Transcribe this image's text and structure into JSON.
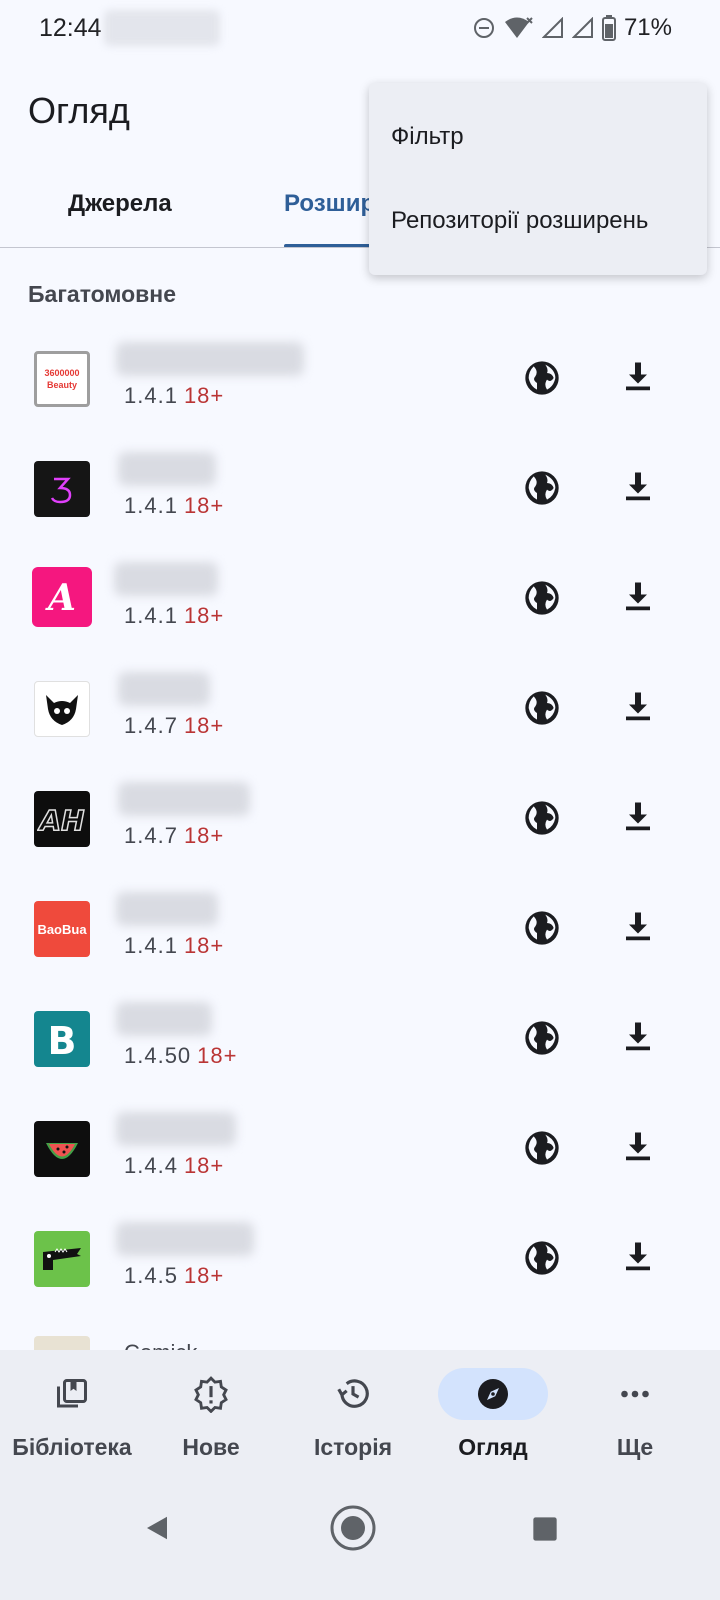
{
  "status_bar": {
    "time": "12:44",
    "battery_pct": "71%",
    "icons": [
      "dnd-icon",
      "wifi-icon",
      "signal-icon",
      "signal-icon",
      "battery-icon"
    ]
  },
  "app_bar": {
    "title": "Огляд"
  },
  "tabs": [
    {
      "label": "Джерела",
      "active": false
    },
    {
      "label": "Розшир",
      "active": true
    }
  ],
  "menu": {
    "items": [
      {
        "label": "Фільтр"
      },
      {
        "label": "Репозиторії розширень"
      }
    ]
  },
  "section": {
    "header": "Багатомовне"
  },
  "extensions": [
    {
      "icon": "3600000-beauty-icon",
      "icon_text": "3600000\nBeauty",
      "version": "1.4.1",
      "nsfw": "18+"
    },
    {
      "icon": "number-3-icon",
      "version": "1.4.1",
      "nsfw": "18+"
    },
    {
      "icon": "letter-a-icon",
      "version": "1.4.1",
      "nsfw": "18+"
    },
    {
      "icon": "horned-mask-icon",
      "version": "1.4.7",
      "nsfw": "18+"
    },
    {
      "icon": "ah-logo-icon",
      "version": "1.4.7",
      "nsfw": "18+"
    },
    {
      "icon": "baobua-logo-icon",
      "icon_text": "BaoBua",
      "version": "1.4.1",
      "nsfw": "18+"
    },
    {
      "icon": "letter-b-icon",
      "icon_text": "B",
      "version": "1.4.50",
      "nsfw": "18+"
    },
    {
      "icon": "watermelon-icon",
      "version": "1.4.4",
      "nsfw": "18+"
    },
    {
      "icon": "crocodile-icon",
      "version": "1.4.5",
      "nsfw": "18+"
    }
  ],
  "peek_row": {
    "name": "Comick"
  },
  "bottom_nav": [
    {
      "label": "Бібліотека",
      "icon": "library-icon",
      "active": false
    },
    {
      "label": "Нове",
      "icon": "updates-icon",
      "active": false
    },
    {
      "label": "Історія",
      "icon": "history-icon",
      "active": false
    },
    {
      "label": "Огляд",
      "icon": "explore-icon",
      "active": true
    },
    {
      "label": "Ще",
      "icon": "more-icon",
      "active": false
    }
  ],
  "colors": {
    "accent": "#2f5f98",
    "nsfw": "#ba3535",
    "active_pill": "#d3e3fd"
  }
}
